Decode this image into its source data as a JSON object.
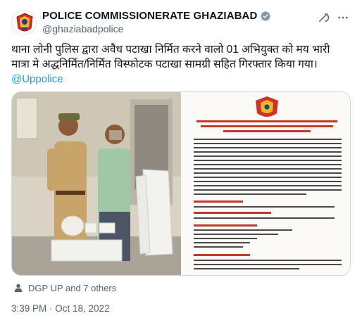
{
  "account": {
    "display_name": "POLICE COMMISSIONERATE GHAZIABAD",
    "handle": "@ghaziabadpolice"
  },
  "tweet": {
    "text": "थाना लोनी पुलिस द्वारा अवैध पटाखा निर्मित करने वालो 01 अभियुक्त को मय भारी मात्रा मे अद्धनिर्मित/निर्मित विस्फोटक पटाखा सामग्री सहित गिरफ्तार किया गया।",
    "mention": "@Uppolice"
  },
  "media": {
    "doc_heading": "थाना लोनी पुलिस द्वारा अवैध पटाखा निर्मित करने वाले 01 अभियुक्त को मय भारी मात्रा में अद्धनिर्मित/निर्मित विस्फोटक पटाखा सामग्री सहित गिरफ्तार",
    "arrestee_label": "गिरफ्तार अभियुक्त का विवरण",
    "recovery_label": "बरामदगी का विवरण"
  },
  "tagged": {
    "text": "DGP UP and 7 others"
  },
  "footer": {
    "timestamp": "3:39 PM · Oct 18, 2022"
  },
  "colors": {
    "link": "#1d9bf0",
    "verified": "#829aab",
    "doc_red": "#c0392b",
    "muted": "#536471"
  },
  "icons": {
    "avatar": "up-police-emblem-icon",
    "verified": "verified-badge-icon",
    "grok": "grok-icon",
    "more": "more-options-icon",
    "tagged": "person-icon"
  }
}
